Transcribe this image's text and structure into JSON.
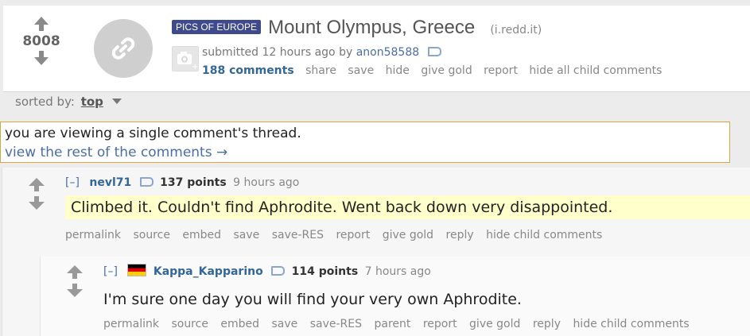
{
  "post": {
    "score": "8008",
    "flair": "PICS OF EUROPE",
    "title": "Mount Olympus, Greece",
    "domain": "(i.redd.it)",
    "submitted_prefix": "submitted 12 hours ago by",
    "author": "anon58588",
    "buttons": {
      "comments": "188 comments",
      "share": "share",
      "save": "save",
      "hide": "hide",
      "give_gold": "give gold",
      "report": "report",
      "hide_all": "hide all child comments"
    }
  },
  "sort": {
    "label": "sorted by:",
    "value": "top"
  },
  "notice": {
    "line1": "you are viewing a single comment's thread.",
    "line2": "view the rest of the comments →"
  },
  "comments": [
    {
      "toggle": "[–]",
      "author": "nevl71",
      "points": "137 points",
      "age": "9 hours ago",
      "body": "Climbed it. Couldn't find Aphrodite. Went back down very disappointed.",
      "buttons": {
        "permalink": "permalink",
        "source": "source",
        "embed": "embed",
        "save": "save",
        "save_res": "save-RES",
        "report": "report",
        "give_gold": "give gold",
        "reply": "reply",
        "hide_child": "hide child comments"
      }
    },
    {
      "toggle": "[–]",
      "author": "Kappa_Kapparino",
      "points": "114 points",
      "age": "7 hours ago",
      "body": "I'm sure one day you will find your very own Aphrodite.",
      "buttons": {
        "permalink": "permalink",
        "source": "source",
        "embed": "embed",
        "save": "save",
        "save_res": "save-RES",
        "parent": "parent",
        "report": "report",
        "give_gold": "give gold",
        "reply": "reply",
        "hide_child": "hide child comments"
      }
    }
  ],
  "colors": {
    "flair_bg": "#3e4a8c",
    "link_blue": "#336699",
    "highlight_yellow": "#ffffcc",
    "notice_border": "#d9a443"
  },
  "icons": [
    "upvote-arrow-icon",
    "downvote-arrow-icon",
    "link-icon",
    "camera-icon",
    "tag-icon",
    "flag-icon",
    "caret-down-icon"
  ]
}
